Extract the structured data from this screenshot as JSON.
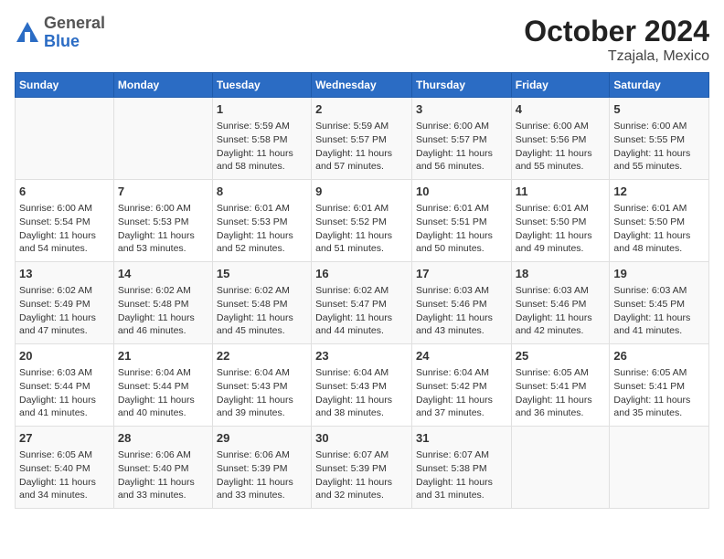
{
  "logo": {
    "general": "General",
    "blue": "Blue"
  },
  "title": "October 2024",
  "subtitle": "Tzajala, Mexico",
  "days_of_week": [
    "Sunday",
    "Monday",
    "Tuesday",
    "Wednesday",
    "Thursday",
    "Friday",
    "Saturday"
  ],
  "weeks": [
    [
      {
        "day": "",
        "info": ""
      },
      {
        "day": "",
        "info": ""
      },
      {
        "day": "1",
        "info": "Sunrise: 5:59 AM\nSunset: 5:58 PM\nDaylight: 11 hours and 58 minutes."
      },
      {
        "day": "2",
        "info": "Sunrise: 5:59 AM\nSunset: 5:57 PM\nDaylight: 11 hours and 57 minutes."
      },
      {
        "day": "3",
        "info": "Sunrise: 6:00 AM\nSunset: 5:57 PM\nDaylight: 11 hours and 56 minutes."
      },
      {
        "day": "4",
        "info": "Sunrise: 6:00 AM\nSunset: 5:56 PM\nDaylight: 11 hours and 55 minutes."
      },
      {
        "day": "5",
        "info": "Sunrise: 6:00 AM\nSunset: 5:55 PM\nDaylight: 11 hours and 55 minutes."
      }
    ],
    [
      {
        "day": "6",
        "info": "Sunrise: 6:00 AM\nSunset: 5:54 PM\nDaylight: 11 hours and 54 minutes."
      },
      {
        "day": "7",
        "info": "Sunrise: 6:00 AM\nSunset: 5:53 PM\nDaylight: 11 hours and 53 minutes."
      },
      {
        "day": "8",
        "info": "Sunrise: 6:01 AM\nSunset: 5:53 PM\nDaylight: 11 hours and 52 minutes."
      },
      {
        "day": "9",
        "info": "Sunrise: 6:01 AM\nSunset: 5:52 PM\nDaylight: 11 hours and 51 minutes."
      },
      {
        "day": "10",
        "info": "Sunrise: 6:01 AM\nSunset: 5:51 PM\nDaylight: 11 hours and 50 minutes."
      },
      {
        "day": "11",
        "info": "Sunrise: 6:01 AM\nSunset: 5:50 PM\nDaylight: 11 hours and 49 minutes."
      },
      {
        "day": "12",
        "info": "Sunrise: 6:01 AM\nSunset: 5:50 PM\nDaylight: 11 hours and 48 minutes."
      }
    ],
    [
      {
        "day": "13",
        "info": "Sunrise: 6:02 AM\nSunset: 5:49 PM\nDaylight: 11 hours and 47 minutes."
      },
      {
        "day": "14",
        "info": "Sunrise: 6:02 AM\nSunset: 5:48 PM\nDaylight: 11 hours and 46 minutes."
      },
      {
        "day": "15",
        "info": "Sunrise: 6:02 AM\nSunset: 5:48 PM\nDaylight: 11 hours and 45 minutes."
      },
      {
        "day": "16",
        "info": "Sunrise: 6:02 AM\nSunset: 5:47 PM\nDaylight: 11 hours and 44 minutes."
      },
      {
        "day": "17",
        "info": "Sunrise: 6:03 AM\nSunset: 5:46 PM\nDaylight: 11 hours and 43 minutes."
      },
      {
        "day": "18",
        "info": "Sunrise: 6:03 AM\nSunset: 5:46 PM\nDaylight: 11 hours and 42 minutes."
      },
      {
        "day": "19",
        "info": "Sunrise: 6:03 AM\nSunset: 5:45 PM\nDaylight: 11 hours and 41 minutes."
      }
    ],
    [
      {
        "day": "20",
        "info": "Sunrise: 6:03 AM\nSunset: 5:44 PM\nDaylight: 11 hours and 41 minutes."
      },
      {
        "day": "21",
        "info": "Sunrise: 6:04 AM\nSunset: 5:44 PM\nDaylight: 11 hours and 40 minutes."
      },
      {
        "day": "22",
        "info": "Sunrise: 6:04 AM\nSunset: 5:43 PM\nDaylight: 11 hours and 39 minutes."
      },
      {
        "day": "23",
        "info": "Sunrise: 6:04 AM\nSunset: 5:43 PM\nDaylight: 11 hours and 38 minutes."
      },
      {
        "day": "24",
        "info": "Sunrise: 6:04 AM\nSunset: 5:42 PM\nDaylight: 11 hours and 37 minutes."
      },
      {
        "day": "25",
        "info": "Sunrise: 6:05 AM\nSunset: 5:41 PM\nDaylight: 11 hours and 36 minutes."
      },
      {
        "day": "26",
        "info": "Sunrise: 6:05 AM\nSunset: 5:41 PM\nDaylight: 11 hours and 35 minutes."
      }
    ],
    [
      {
        "day": "27",
        "info": "Sunrise: 6:05 AM\nSunset: 5:40 PM\nDaylight: 11 hours and 34 minutes."
      },
      {
        "day": "28",
        "info": "Sunrise: 6:06 AM\nSunset: 5:40 PM\nDaylight: 11 hours and 33 minutes."
      },
      {
        "day": "29",
        "info": "Sunrise: 6:06 AM\nSunset: 5:39 PM\nDaylight: 11 hours and 33 minutes."
      },
      {
        "day": "30",
        "info": "Sunrise: 6:07 AM\nSunset: 5:39 PM\nDaylight: 11 hours and 32 minutes."
      },
      {
        "day": "31",
        "info": "Sunrise: 6:07 AM\nSunset: 5:38 PM\nDaylight: 11 hours and 31 minutes."
      },
      {
        "day": "",
        "info": ""
      },
      {
        "day": "",
        "info": ""
      }
    ]
  ]
}
